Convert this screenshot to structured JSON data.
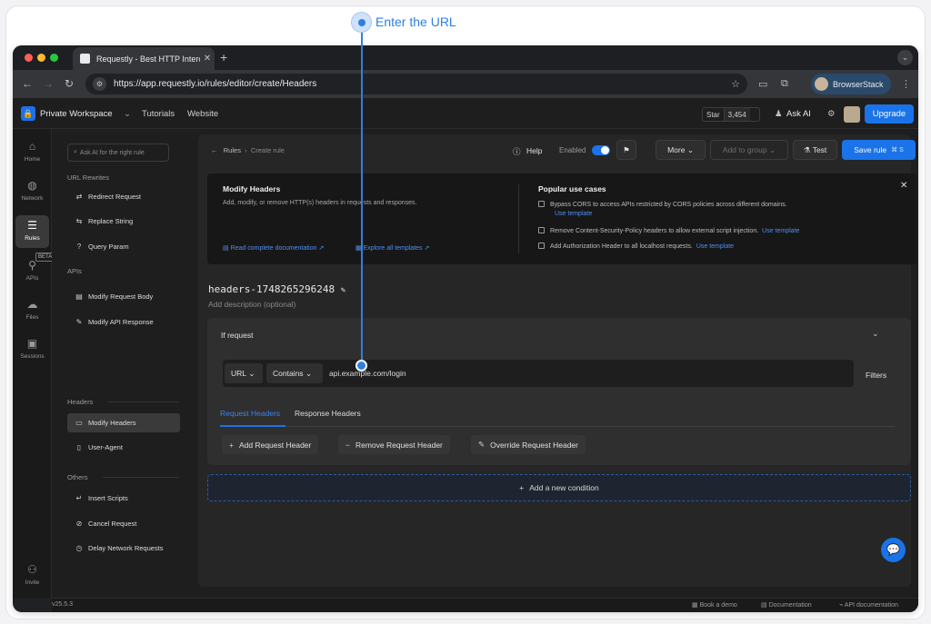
{
  "callout": {
    "label": "Enter the URL"
  },
  "browser": {
    "tab_title": "Requestly - Best HTTP Interc",
    "new_tab": "+",
    "url": "https://app.requestly.io/rules/editor/create/Headers",
    "profile_label": "BrowserStack"
  },
  "appbar": {
    "workspace": "Private Workspace",
    "links": [
      "Tutorials",
      "Website"
    ],
    "github_star": "Star",
    "github_count": "3,454",
    "ask_ai": "Ask AI",
    "upgrade": "Upgrade"
  },
  "rail": {
    "items": [
      {
        "label": "Home",
        "icon": "home-icon"
      },
      {
        "label": "Network",
        "icon": "globe-icon"
      },
      {
        "label": "Rules",
        "icon": "sliders-icon"
      },
      {
        "label": "APIs",
        "icon": "rocket-icon"
      },
      {
        "label": "Files",
        "icon": "cloud-icon"
      },
      {
        "label": "Sessions",
        "icon": "video-icon"
      }
    ],
    "beta": "BETA",
    "invite": "Invite",
    "version": "v25.5.3"
  },
  "sidebar": {
    "ai_placeholder": "Ask AI for the right rule",
    "sections": {
      "url_rewrites": "URL Rewrites",
      "apis": "APIs",
      "headers": "Headers",
      "others": "Others"
    },
    "items": {
      "redirect": "Redirect Request",
      "replace": "Replace String",
      "query": "Query Param",
      "modify_body": "Modify Request Body",
      "modify_api": "Modify API Response",
      "modify_headers": "Modify Headers",
      "user_agent": "User-Agent",
      "insert_scripts": "Insert Scripts",
      "cancel": "Cancel Request",
      "delay": "Delay Network Requests"
    }
  },
  "header": {
    "crumb_root": "Rules",
    "crumb_current": "Create rule",
    "help": "Help",
    "enabled": "Enabled",
    "more": "More",
    "add_to_group": "Add to group",
    "test": "Test",
    "save_rule": "Save rule",
    "save_shortcut": "⌘ S"
  },
  "info": {
    "title": "Modify Headers",
    "description": "Add, modify, or remove HTTP(s) headers in requests and responses.",
    "doc_link": "Read complete documentation",
    "templates_link": "Explore all templates",
    "popular_title": "Popular use cases",
    "use_cases": [
      {
        "text": "Bypass CORS to access APIs restricted by CORS policies across different domains.",
        "link": "Use template"
      },
      {
        "text": "Remove Content-Security-Policy headers to allow external script injection.",
        "link": "Use template"
      },
      {
        "text": "Add Authorization Header to all localhost requests.",
        "link": "Use template"
      }
    ]
  },
  "rule": {
    "name": "headers-1748265296248",
    "description_placeholder": "Add description (optional)"
  },
  "condition": {
    "title": "If request",
    "match_field": "URL",
    "operator": "Contains",
    "value": "api.example.com/login",
    "filters": "Filters",
    "tabs": [
      "Request Headers",
      "Response Headers"
    ],
    "active_tab": "Request Headers",
    "actions": [
      "Add Request Header",
      "Remove Request Header",
      "Override Request Header"
    ],
    "add_condition": "Add a new condition"
  },
  "footer": {
    "links": [
      "Book a demo",
      "Documentation",
      "API documentation"
    ]
  },
  "colors": {
    "accent": "#1a73e8",
    "callout": "#2f7fe0"
  }
}
